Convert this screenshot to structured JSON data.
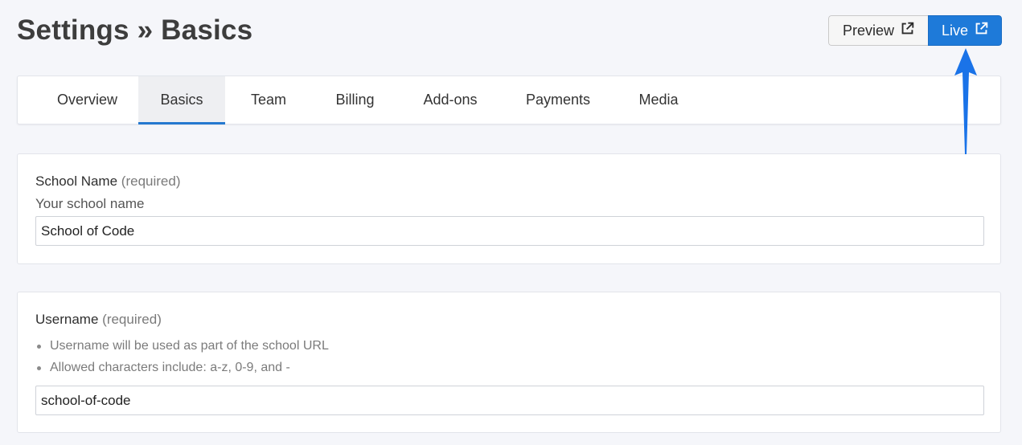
{
  "header": {
    "title": "Settings » Basics",
    "preview_label": "Preview",
    "live_label": "Live",
    "external_icon": "external-link-icon"
  },
  "tabs": [
    {
      "label": "Overview",
      "active": false
    },
    {
      "label": "Basics",
      "active": true
    },
    {
      "label": "Team",
      "active": false
    },
    {
      "label": "Billing",
      "active": false
    },
    {
      "label": "Add-ons",
      "active": false
    },
    {
      "label": "Payments",
      "active": false
    },
    {
      "label": "Media",
      "active": false
    }
  ],
  "school_name": {
    "label": "School Name",
    "required": "(required)",
    "help": "Your school name",
    "value": "School of Code"
  },
  "username": {
    "label": "Username",
    "required": "(required)",
    "bullets": [
      "Username will be used as part of the school URL",
      "Allowed characters include: a-z, 0-9, and -"
    ],
    "value": "school-of-code"
  },
  "colors": {
    "accent": "#1e7ad9",
    "annotation_arrow": "#1a73e8"
  }
}
